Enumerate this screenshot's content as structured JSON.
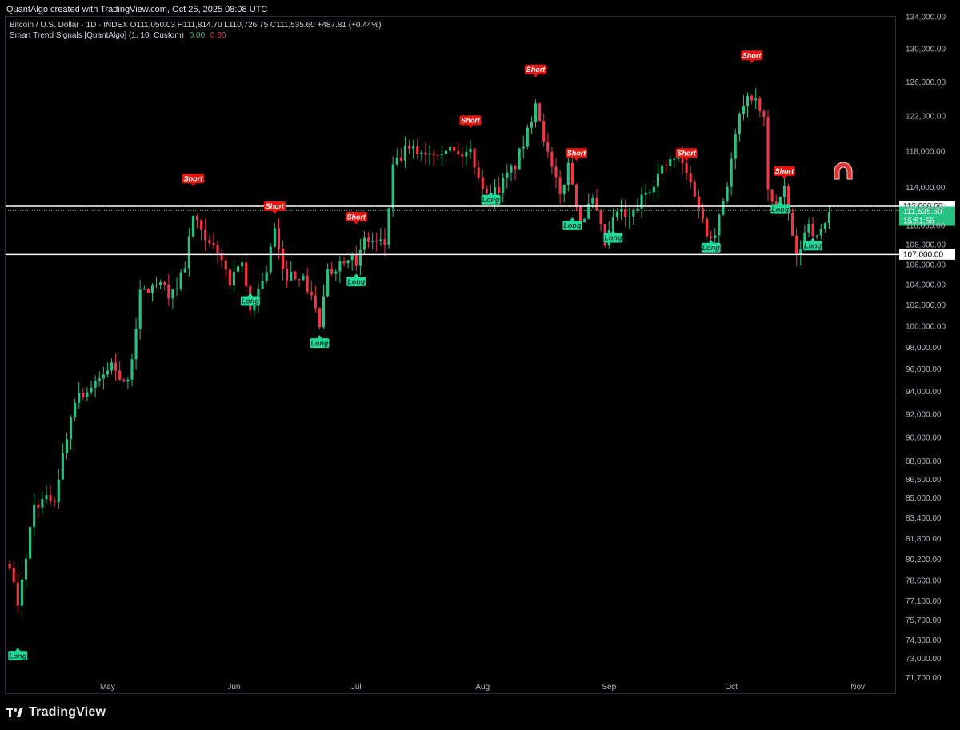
{
  "caption": "QuantAlgo created with TradingView.com, Oct 25, 2025 08:08 UTC",
  "legend": {
    "symbol": "Bitcoin / U.S. Dollar · 1D · INDEX",
    "ohlc": "O111,050.03  H111,814.70  L110,726.75  C111,535.60  +487.81 (+0.44%)",
    "indicator": "Smart Trend Signals [QuantAlgo] (1, 10, Custom)",
    "ind_val1": "0.00",
    "ind_val2": "0.00"
  },
  "footer": {
    "brand": "TradingView",
    "logo_icon": "tradingview-logo-icon"
  },
  "colors": {
    "up": "#26c281",
    "down": "#f23645",
    "long_badge": "#22d99b",
    "short_badge": "#e8150f",
    "magnet": "#e03030"
  },
  "chart_data": {
    "type": "candlestick",
    "title": "",
    "xlabel": "",
    "ylabel": "",
    "y_scale": "log",
    "ylim": [
      70700,
      134000
    ],
    "xlim": [
      "2025-04-06",
      "2025-11-10"
    ],
    "grid": false,
    "y_ticks": [
      "134,000.00",
      "130,000.00",
      "126,000.00",
      "122,000.00",
      "118,000.00",
      "114,000.00",
      "112,000.00",
      "110,000.00",
      "108,000.00",
      "106,000.00",
      "104,000.00",
      "102,000.00",
      "100,000.00",
      "98,000.00",
      "96,000.00",
      "94,000.00",
      "92,000.00",
      "90,000.00",
      "88,000.00",
      "86,500.00",
      "85,000.00",
      "83,400.00",
      "81,800.00",
      "80,200.00",
      "78,600.00",
      "77,100.00",
      "75,700.00",
      "74,300.00",
      "73,000.00",
      "71,700.00"
    ],
    "x_ticks": [
      {
        "label": "May",
        "date": "2025-05-01"
      },
      {
        "label": "Jun",
        "date": "2025-06-01"
      },
      {
        "label": "Jul",
        "date": "2025-07-01"
      },
      {
        "label": "Aug",
        "date": "2025-08-01"
      },
      {
        "label": "Sep",
        "date": "2025-09-01"
      },
      {
        "label": "Oct",
        "date": "2025-10-01"
      },
      {
        "label": "Nov",
        "date": "2025-11-01"
      }
    ],
    "horizontal_lines": [
      {
        "value": 112000,
        "label": "112,000.00",
        "style": "solid"
      },
      {
        "value": 107000,
        "label": "107,000.00",
        "style": "solid"
      },
      {
        "value": 111535.6,
        "label": "111,535.60",
        "style": "dotted",
        "countdown": "15:51:55"
      }
    ],
    "anchors": [
      [
        "2025-04-07",
        80000
      ],
      [
        "2025-04-09",
        76500
      ],
      [
        "2025-04-13",
        84500
      ],
      [
        "2025-04-18",
        85000
      ],
      [
        "2025-04-23",
        93500
      ],
      [
        "2025-04-28",
        94500
      ],
      [
        "2025-05-02",
        96500
      ],
      [
        "2025-05-06",
        94500
      ],
      [
        "2025-05-09",
        103000
      ],
      [
        "2025-05-13",
        104000
      ],
      [
        "2025-05-17",
        103000
      ],
      [
        "2025-05-20",
        106000
      ],
      [
        "2025-05-22",
        111000
      ],
      [
        "2025-05-25",
        108000
      ],
      [
        "2025-05-28",
        107500
      ],
      [
        "2025-05-31",
        104000
      ],
      [
        "2025-06-03",
        106000
      ],
      [
        "2025-06-05",
        101500
      ],
      [
        "2025-06-09",
        105500
      ],
      [
        "2025-06-11",
        109500
      ],
      [
        "2025-06-13",
        105000
      ],
      [
        "2025-06-17",
        105000
      ],
      [
        "2025-06-20",
        103000
      ],
      [
        "2025-06-22",
        100000
      ],
      [
        "2025-06-24",
        105000
      ],
      [
        "2025-06-30",
        107500
      ],
      [
        "2025-07-01",
        105500
      ],
      [
        "2025-07-03",
        108500
      ],
      [
        "2025-07-08",
        108000
      ],
      [
        "2025-07-10",
        116000
      ],
      [
        "2025-07-13",
        118000
      ],
      [
        "2025-07-19",
        118000
      ],
      [
        "2025-07-23",
        118500
      ],
      [
        "2025-07-26",
        117500
      ],
      [
        "2025-07-29",
        118000
      ],
      [
        "2025-08-02",
        113000
      ],
      [
        "2025-08-05",
        114000
      ],
      [
        "2025-08-09",
        116500
      ],
      [
        "2025-08-12",
        120000
      ],
      [
        "2025-08-14",
        124000
      ],
      [
        "2025-08-17",
        117500
      ],
      [
        "2025-08-20",
        113000
      ],
      [
        "2025-08-22",
        116500
      ],
      [
        "2025-08-25",
        110500
      ],
      [
        "2025-08-28",
        112500
      ],
      [
        "2025-08-31",
        108000
      ],
      [
        "2025-09-03",
        111500
      ],
      [
        "2025-09-06",
        110500
      ],
      [
        "2025-09-10",
        113500
      ],
      [
        "2025-09-14",
        116000
      ],
      [
        "2025-09-18",
        117500
      ],
      [
        "2025-09-22",
        113500
      ],
      [
        "2025-09-25",
        109000
      ],
      [
        "2025-09-27",
        109500
      ],
      [
        "2025-09-30",
        114500
      ],
      [
        "2025-10-03",
        122000
      ],
      [
        "2025-10-06",
        124500
      ],
      [
        "2025-10-09",
        121500
      ],
      [
        "2025-10-10",
        113500
      ],
      [
        "2025-10-12",
        112000
      ],
      [
        "2025-10-14",
        113500
      ],
      [
        "2025-10-17",
        106500
      ],
      [
        "2025-10-20",
        110500
      ],
      [
        "2025-10-22",
        108500
      ],
      [
        "2025-10-25",
        111500
      ]
    ],
    "signals": [
      {
        "type": "Long",
        "date": "2025-04-09",
        "price": 73200
      },
      {
        "type": "Short",
        "date": "2025-05-22",
        "price": 115000
      },
      {
        "type": "Long",
        "date": "2025-06-05",
        "price": 102400
      },
      {
        "type": "Short",
        "date": "2025-06-11",
        "price": 112000
      },
      {
        "type": "Long",
        "date": "2025-06-22",
        "price": 98400
      },
      {
        "type": "Short",
        "date": "2025-07-01",
        "price": 110900
      },
      {
        "type": "Long",
        "date": "2025-07-01",
        "price": 104300
      },
      {
        "type": "Short",
        "date": "2025-07-29",
        "price": 121500
      },
      {
        "type": "Long",
        "date": "2025-08-03",
        "price": 112700
      },
      {
        "type": "Short",
        "date": "2025-08-14",
        "price": 127500
      },
      {
        "type": "Short",
        "date": "2025-08-24",
        "price": 117800
      },
      {
        "type": "Long",
        "date": "2025-08-23",
        "price": 110000
      },
      {
        "type": "Long",
        "date": "2025-09-02",
        "price": 108700
      },
      {
        "type": "Short",
        "date": "2025-09-20",
        "price": 117800
      },
      {
        "type": "Long",
        "date": "2025-09-26",
        "price": 107700
      },
      {
        "type": "Short",
        "date": "2025-10-06",
        "price": 129200
      },
      {
        "type": "Short",
        "date": "2025-10-14",
        "price": 115800
      },
      {
        "type": "Long",
        "date": "2025-10-13",
        "price": 111700
      },
      {
        "type": "Long",
        "date": "2025-10-21",
        "price": 107900
      }
    ]
  }
}
